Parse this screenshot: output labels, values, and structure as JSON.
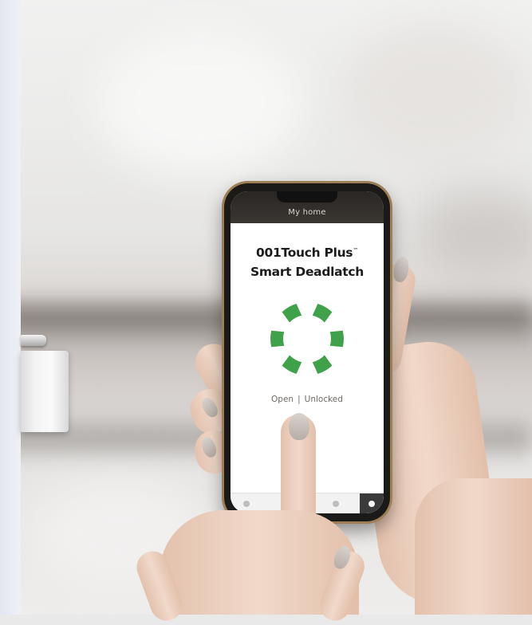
{
  "app": {
    "header_title": "My home",
    "lock_name_line1": "001Touch Plus",
    "trademark": "™",
    "lock_name_line2": "Smart Deadlatch",
    "status_open": "Open",
    "status_separator": "|",
    "status_locked_state": "Unlocked",
    "lock_indicator_color": "#3fa24a",
    "lock_indicator_segments": 6,
    "tabs": [
      "home-tab-icon",
      "devices-tab-icon",
      "settings-tab-icon"
    ],
    "active_tab": "settings-tab-icon"
  },
  "scene": {
    "accent_phone_frame": "#9c7f55",
    "wall_tint": "#e3e6ef"
  }
}
